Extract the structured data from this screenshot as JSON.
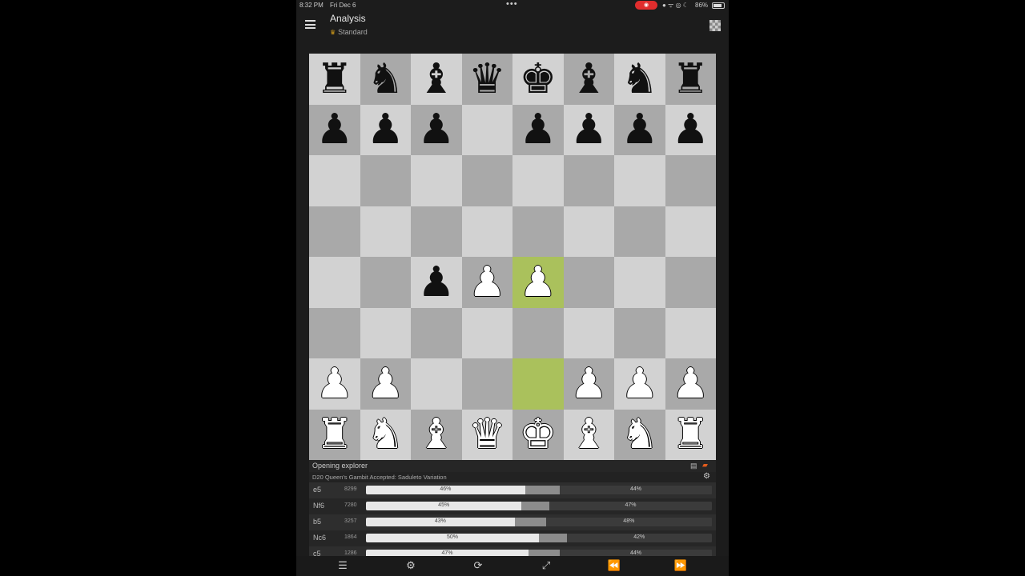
{
  "statusbar": {
    "time": "8:32 PM",
    "date": "Fri Dec 6",
    "dots": "•••",
    "rec": "◉",
    "icons": "● ᯤ ◎ ☾",
    "battery": "86%"
  },
  "app": {
    "title": "Analysis",
    "subtitle": "Standard"
  },
  "board": {
    "highlight": [
      "e4",
      "e2"
    ],
    "ranks": [
      [
        "bR",
        "bN",
        "bB",
        "bQ",
        "bK",
        "bB",
        "bN",
        "bR"
      ],
      [
        "bP",
        "bP",
        "bP",
        "",
        "bP",
        "bP",
        "bP",
        "bP"
      ],
      [
        "",
        "",
        "",
        "",
        "",
        "",
        "",
        ""
      ],
      [
        "",
        "",
        "",
        "",
        "",
        "",
        "",
        ""
      ],
      [
        "",
        "",
        "bP",
        "wP",
        "wP",
        "",
        "",
        ""
      ],
      [
        "",
        "",
        "",
        "",
        "",
        "",
        "",
        ""
      ],
      [
        "wP",
        "wP",
        "",
        "",
        "",
        "wP",
        "wP",
        "wP"
      ],
      [
        "wR",
        "wN",
        "wB",
        "wQ",
        "wK",
        "wB",
        "wN",
        "wR"
      ]
    ]
  },
  "explorer": {
    "title": "Opening explorer",
    "opening": "D20 Queen's Gambit Accepted: Saduleto Variation",
    "rows": [
      {
        "move": "e5",
        "games": "8299",
        "white": 46,
        "draw": 10,
        "black": 44,
        "white_label": "46%",
        "black_label": "44%"
      },
      {
        "move": "Nf6",
        "games": "7280",
        "white": 45,
        "draw": 8,
        "black": 47,
        "white_label": "45%",
        "black_label": "47%"
      },
      {
        "move": "b5",
        "games": "3257",
        "white": 43,
        "draw": 9,
        "black": 48,
        "white_label": "43%",
        "black_label": "48%"
      },
      {
        "move": "Nc6",
        "games": "1864",
        "white": 50,
        "draw": 8,
        "black": 42,
        "white_label": "50%",
        "black_label": "42%"
      },
      {
        "move": "c5",
        "games": "1286",
        "white": 47,
        "draw": 9,
        "black": 44,
        "white_label": "47%",
        "black_label": "44%"
      }
    ]
  },
  "bottombar": {
    "moves": "☰",
    "settings": "⚙",
    "flip": "⟳",
    "engine": "⤢",
    "back": "⏪",
    "forward": "⏩"
  },
  "icons": {
    "menu": "menu-icon",
    "board": "board-icon",
    "list": "list-icon",
    "book": "book-icon",
    "gear": "gear-icon"
  }
}
